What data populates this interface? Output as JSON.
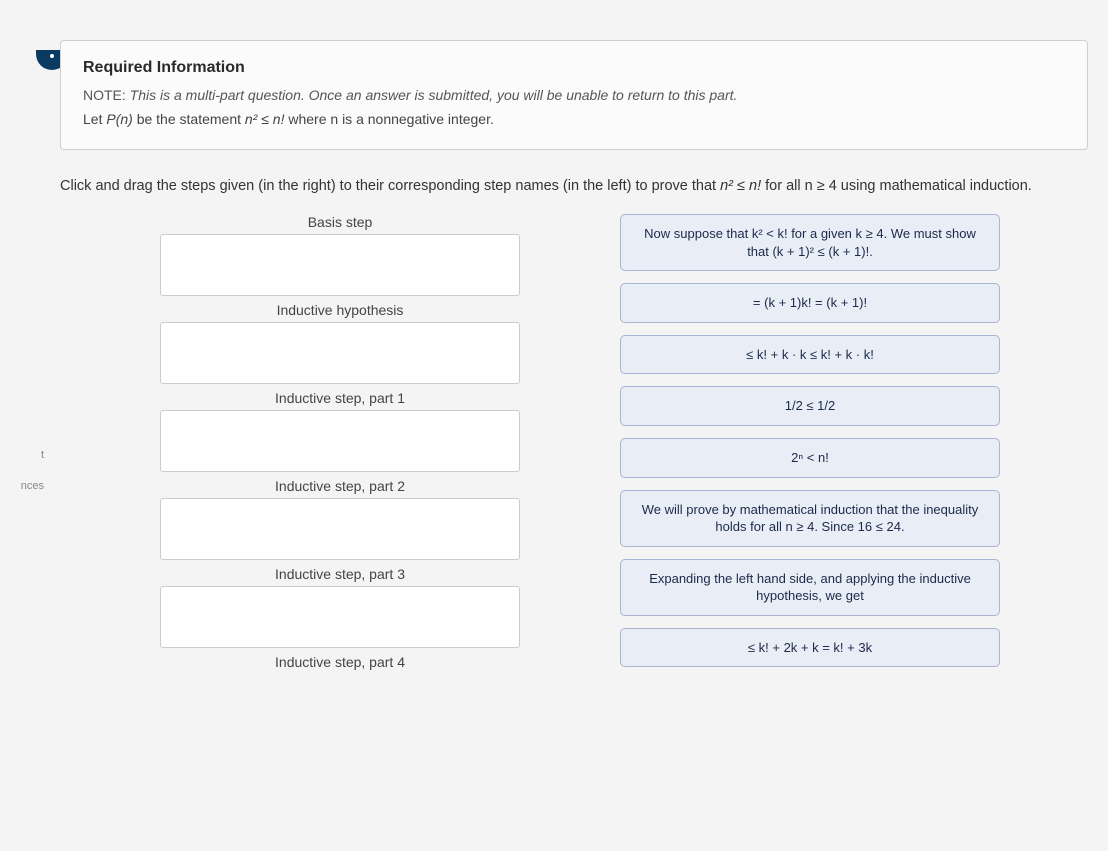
{
  "info": {
    "title": "Required Information",
    "note_prefix": "NOTE:",
    "note_body": "This is a multi-part question. Once an answer is submitted, you will be unable to return to this part.",
    "statement_pre": "Let ",
    "statement_pn": "P(n)",
    "statement_mid": " be the statement ",
    "statement_math": "n² ≤ n!",
    "statement_post": " where n is a nonnegative integer."
  },
  "instructions": {
    "pre": "Click and drag the steps given (in the right) to their corresponding step names (in the left) to prove that ",
    "math": "n² ≤ n!",
    "post": " for all n ≥ 4 using mathematical induction."
  },
  "steps": [
    "Basis step",
    "Inductive hypothesis",
    "Inductive step, part 1",
    "Inductive step, part 2",
    "Inductive step, part 3",
    "Inductive step, part 4"
  ],
  "drag_items": [
    "Now suppose that k² < k! for a given k ≥ 4. We must show that (k + 1)² ≤ (k + 1)!.",
    "= (k + 1)k! = (k + 1)!",
    "≤ k! + k · k ≤ k! + k · k!",
    "1/2 ≤ 1/2",
    "2ⁿ < n!",
    "We will prove by mathematical induction that the inequality holds for all n ≥ 4. Since 16 ≤ 24.",
    "Expanding the left hand side, and applying the inductive hypothesis, we get",
    "≤ k! + 2k + k = k! + 3k"
  ],
  "sidebar": {
    "item1": "t",
    "item2": "nces"
  }
}
